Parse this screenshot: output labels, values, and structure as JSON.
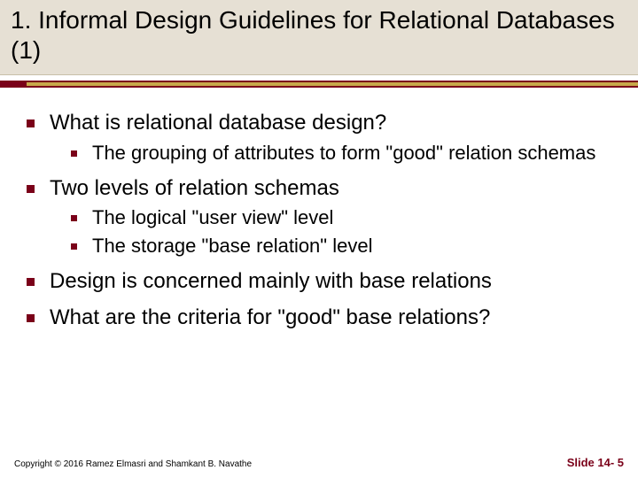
{
  "title": "1. Informal Design Guidelines for Relational Databases (1)",
  "bullets": {
    "b1": "What is relational database design?",
    "b1_1": "The grouping of attributes to form \"good\" relation schemas",
    "b2": "Two levels of relation schemas",
    "b2_1": "The logical \"user view\" level",
    "b2_2": "The storage \"base relation\" level",
    "b3": "Design is concerned mainly with base relations",
    "b4": "What are the criteria for \"good\" base relations?"
  },
  "footer": {
    "copyright": "Copyright © 2016 Ramez Elmasri and Shamkant B. Navathe",
    "slide": "Slide 14- 5"
  }
}
